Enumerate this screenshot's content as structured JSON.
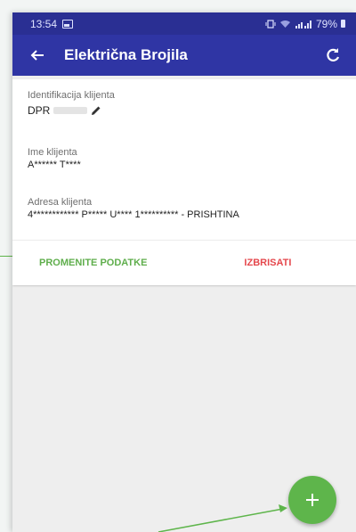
{
  "status_bar": {
    "time": "13:54",
    "battery": "79%",
    "icons": [
      "image-icon",
      "vibrate-icon",
      "wifi-icon",
      "signal-icon",
      "battery-icon"
    ]
  },
  "app_bar": {
    "title": "Električna Brojila",
    "back_icon": "arrow-left-icon",
    "refresh_icon": "refresh-icon"
  },
  "client": {
    "id_label": "Identifikacija klijenta",
    "id_value": "DPR",
    "name_label": "Ime klijenta",
    "name_value": "A****** T****",
    "address_label": "Adresa klijenta",
    "address_value": "4************ P***** U**** 1********** - PRISHTINA"
  },
  "actions": {
    "change_label": "PROMENITE PODATKE",
    "delete_label": "IZBRISATI"
  },
  "fab": {
    "icon": "plus-icon"
  },
  "colors": {
    "primary": "#2f35a4",
    "status_bar": "#2a2f93",
    "accent_green": "#5eb54b",
    "delete_red": "#e5484d"
  }
}
